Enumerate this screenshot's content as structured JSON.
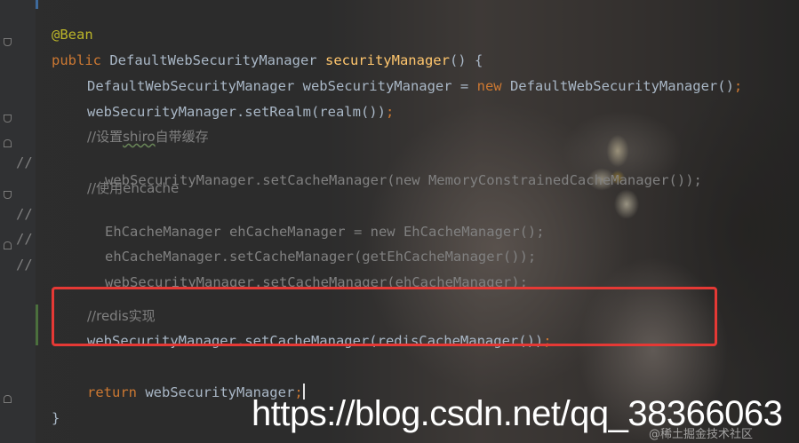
{
  "editor": {
    "lines": {
      "l1": {
        "annotation": "@Bean"
      },
      "l2": {
        "kw_public": "public",
        "type": "DefaultWebSecurityManager",
        "method": "securityManager",
        "rest": "() {"
      },
      "l3": {
        "decl": "DefaultWebSecurityManager webSecurityManager = ",
        "kw_new": "new",
        "ctor": " DefaultWebSecurityManager()",
        "semi": ";"
      },
      "l4": {
        "call": "webSecurityManager.setRealm(realm())",
        "semi": ";"
      },
      "l5": {
        "comment_prefix": "//设置",
        "comment_word": "shiro",
        "comment_suffix": "自带缓存"
      },
      "l6": {
        "marker": "//",
        "code": "webSecurityManager.setCacheManager(new MemoryConstrainedCacheManager());"
      },
      "l7": {
        "comment": "//使用ehcache"
      },
      "l8": {
        "marker": "//",
        "code": "EhCacheManager ehCacheManager = new EhCacheManager();"
      },
      "l9": {
        "marker": "//",
        "code": "ehCacheManager.setCacheManager(getEhCacheManager());"
      },
      "l10": {
        "marker": "//",
        "code": "webSecurityManager.setCacheManager(ehCacheManager);"
      },
      "l12": {
        "comment": "//redis实现"
      },
      "l13": {
        "call": "webSecurityManager.setCacheManager(redisCacheManager())",
        "semi": ";"
      },
      "l15": {
        "kw_return": "return",
        "value": " webSecurityManager",
        "semi": ";"
      },
      "l16": {
        "brace": "}"
      }
    }
  },
  "watermark": {
    "url": "https://blog.csdn.net/qq_38366063",
    "sub": "@稀土掘金技术社区"
  },
  "colors": {
    "keyword": "#cc7832",
    "annotation": "#bbb529",
    "method": "#ffc66d",
    "comment": "#808080",
    "text": "#a9b7c6",
    "highlight_box": "#e53935"
  }
}
